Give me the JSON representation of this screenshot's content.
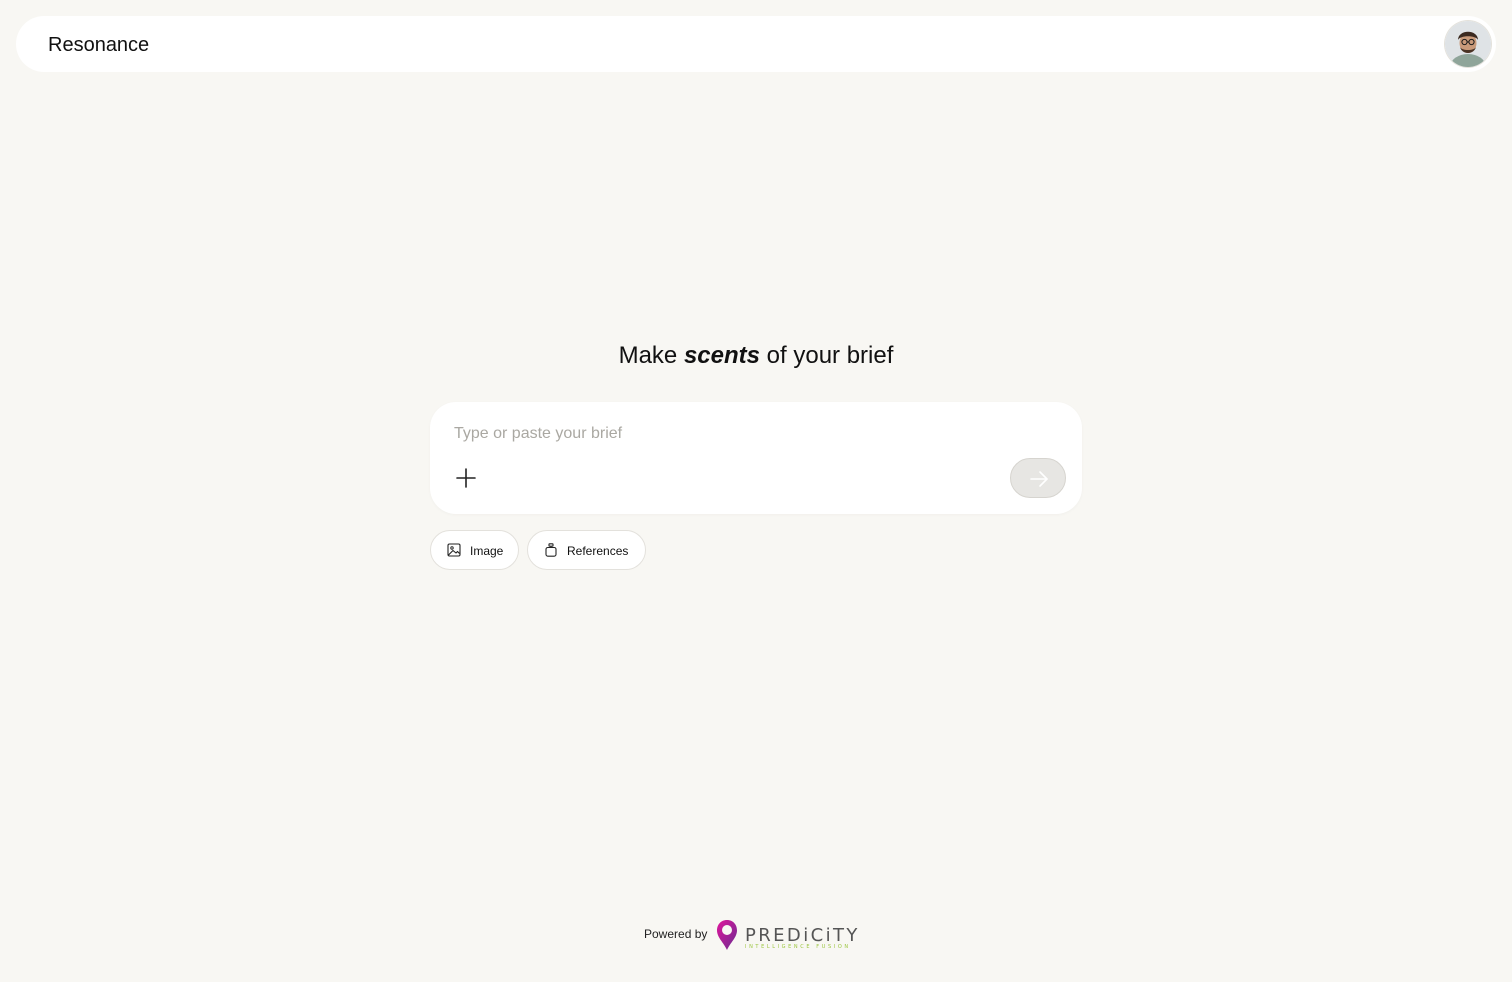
{
  "header": {
    "title": "Resonance",
    "avatar_icon": "user-avatar"
  },
  "hero": {
    "prefix": "Make",
    "emphasis": "scents",
    "suffix": "of your brief"
  },
  "brief": {
    "value": "",
    "placeholder": "Type or paste your brief",
    "add_icon": "plus-icon",
    "send_icon": "arrow-right-icon"
  },
  "chips": [
    {
      "label": "Image",
      "icon": "image-icon"
    },
    {
      "label": "References",
      "icon": "bottle-icon"
    }
  ],
  "footer": {
    "powered_by": "Powered by",
    "brand": "PREDiCiTY",
    "brand_tagline": "INTELLIGENCE FUSION"
  },
  "colors": {
    "background": "#f8f7f3",
    "surface": "#ffffff",
    "brand_magenta": "#c0128a",
    "brand_purple": "#6b2c91",
    "brand_gray": "#555555",
    "tagline_green": "#9bc53d",
    "send_disabled": "#e7e6e3"
  }
}
